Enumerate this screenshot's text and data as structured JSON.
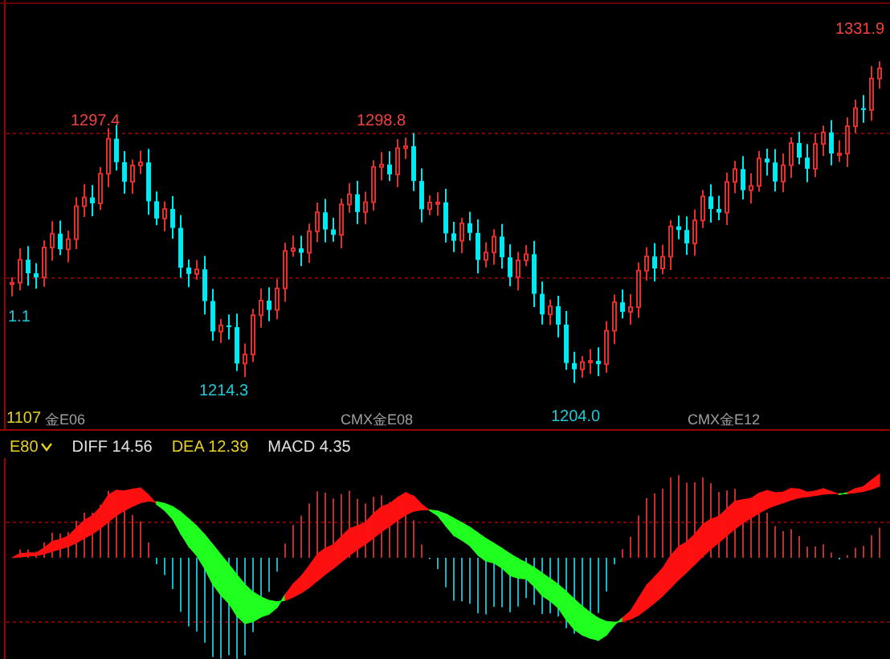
{
  "price_chart": {
    "price_labels": [
      {
        "text": "1297.4",
        "kind": "high"
      },
      {
        "text": "1298.8",
        "kind": "high"
      },
      {
        "text": "1331.9",
        "kind": "high"
      },
      {
        "text": "1.1",
        "kind": "low"
      },
      {
        "text": "1214.3",
        "kind": "low"
      },
      {
        "text": "1204.0",
        "kind": "low"
      }
    ],
    "scale_label": "1107",
    "axis_labels": [
      "金E06",
      "CMX金E08",
      "CMX金E12"
    ]
  },
  "macd": {
    "indicator": "E80",
    "diff": "DIFF 14.56",
    "dea": "DEA 12.39",
    "macd": "MACD 4.35"
  }
}
